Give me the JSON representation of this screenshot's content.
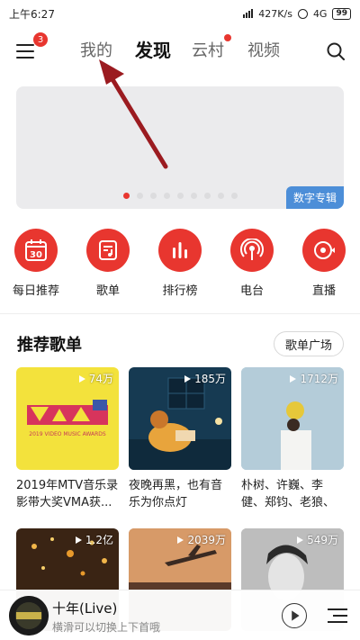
{
  "status": {
    "time": "上午6:27",
    "speed": "427K/s",
    "network": "4G",
    "battery": "99"
  },
  "nav": {
    "menu_badge": "3",
    "tabs": [
      {
        "label": "我的",
        "active": false
      },
      {
        "label": "发现",
        "active": true
      },
      {
        "label": "云村",
        "active": false,
        "dot": true
      },
      {
        "label": "视频",
        "active": false
      }
    ]
  },
  "banner": {
    "tag": "数字专辑",
    "dots": 9,
    "active_dot": 0
  },
  "shortcuts": [
    {
      "label": "每日推荐",
      "icon": "calendar-icon",
      "day": "30"
    },
    {
      "label": "歌单",
      "icon": "playlist-icon"
    },
    {
      "label": "排行榜",
      "icon": "chart-bars-icon"
    },
    {
      "label": "电台",
      "icon": "radio-icon"
    },
    {
      "label": "直播",
      "icon": "live-icon"
    }
  ],
  "section": {
    "title": "推荐歌单",
    "more": "歌单广场"
  },
  "playlists": [
    {
      "plays": "74万",
      "title": "2019年MTV音乐录影带大奖VMA获...",
      "cover_text": "2019 VIDEO MUSIC AWARDS",
      "logo": "VMA"
    },
    {
      "plays": "185万",
      "title": "夜晚再黑，也有音乐为你点灯"
    },
    {
      "plays": "1712万",
      "title": "朴树、许巍、李健、郑钧、老狼、赵雷、..."
    },
    {
      "plays": "1.2亿",
      "title": ""
    },
    {
      "plays": "2039万",
      "title": ""
    },
    {
      "plays": "549万",
      "title": ""
    }
  ],
  "player": {
    "song": "十年(Live)",
    "hint": "横滑可以切换上下首哦"
  },
  "colors": {
    "accent": "#e8362f",
    "banner_tag": "#4c8ed8"
  }
}
